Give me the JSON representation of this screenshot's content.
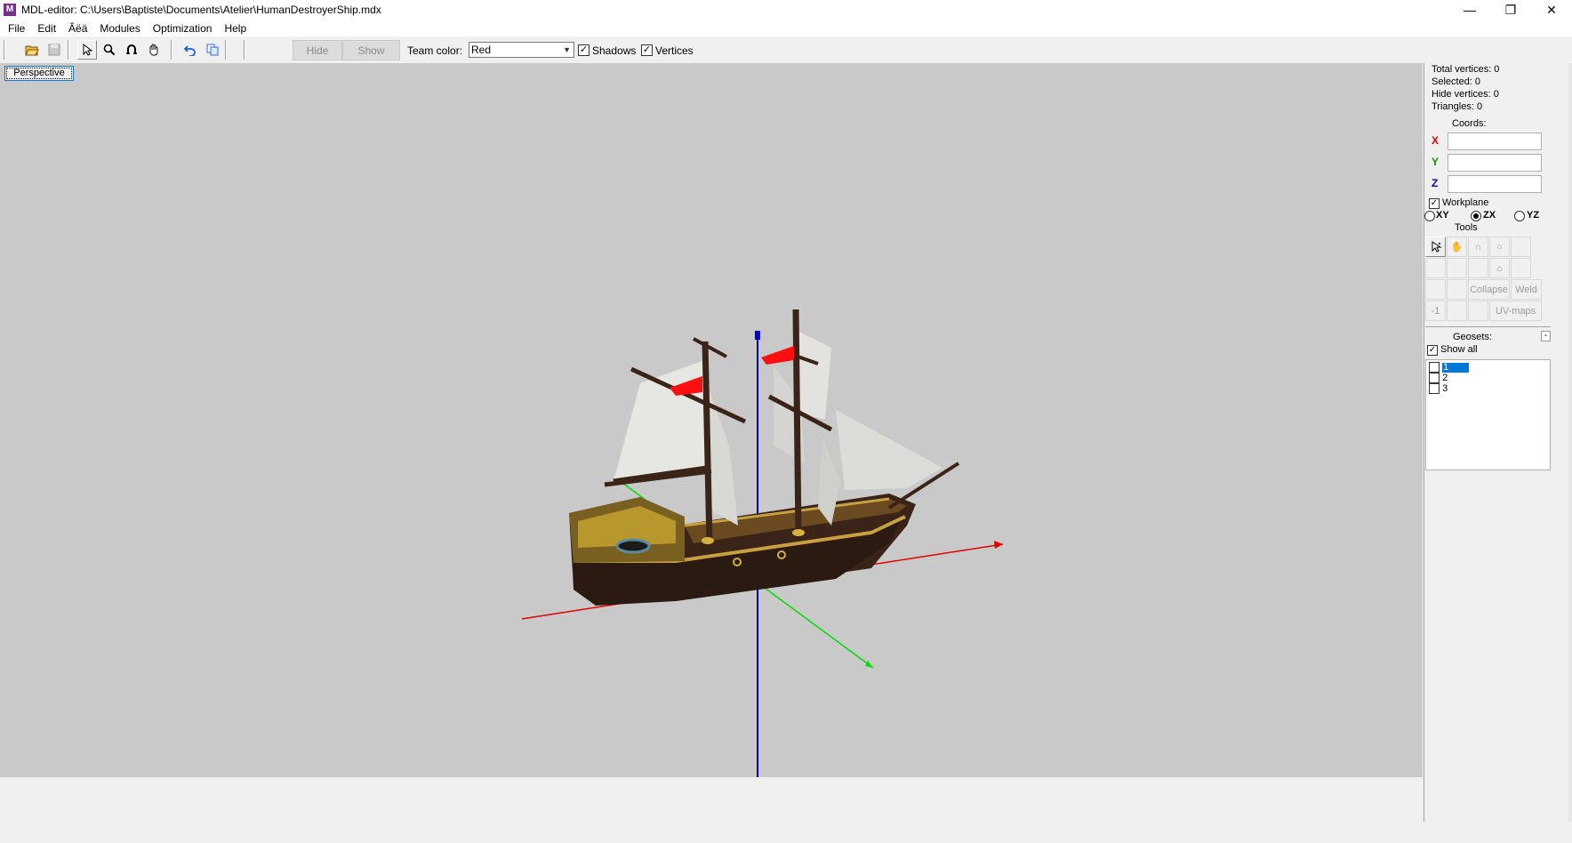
{
  "window": {
    "title": "MDL-editor: C:\\Users\\Baptiste\\Documents\\Atelier\\HumanDestroyerShip.mdx",
    "minimize": "—",
    "restore": "❐",
    "close": "✕"
  },
  "menu": [
    "File",
    "Edit",
    "Âëä",
    "Modules",
    "Optimization",
    "Help"
  ],
  "toolbar": {
    "hide_label": "Hide",
    "show_label": "Show",
    "team_color_label": "Team color:",
    "team_color_value": "Red",
    "shadows_label": "Shadows",
    "shadows_checked": true,
    "vertices_label": "Vertices",
    "vertices_checked": true
  },
  "viewport": {
    "mode_label": "Perspective",
    "axis_colors": {
      "x": "#e00000",
      "y": "#00cc00",
      "z": "#0000cc"
    },
    "background": "#c9c9c9"
  },
  "panel": {
    "total_vertices": "Total vertices: 0",
    "selected": "Selected: 0",
    "hide_vertices": "Hide vertices: 0",
    "triangles": "Triangles: 0",
    "coords_label": "Coords:",
    "x_label": "X",
    "y_label": "Y",
    "z_label": "Z",
    "x_value": "",
    "y_value": "",
    "z_value": "",
    "workplane_label": "Workplane",
    "plane_xy": "XY",
    "plane_zx": "ZX",
    "plane_yz": "YZ",
    "selected_plane": "ZX",
    "tools_label": "Tools",
    "collapse_label": "Collapse",
    "weld_label": "Weld",
    "minus_one_label": "-1",
    "uvmaps_label": "UV-maps",
    "geosets_label": "Geosets:",
    "geosets_collapse": "-",
    "show_all_label": "Show all",
    "geosets": [
      {
        "label": "1",
        "selected": true
      },
      {
        "label": "2",
        "selected": false
      },
      {
        "label": "3",
        "selected": false
      }
    ]
  }
}
